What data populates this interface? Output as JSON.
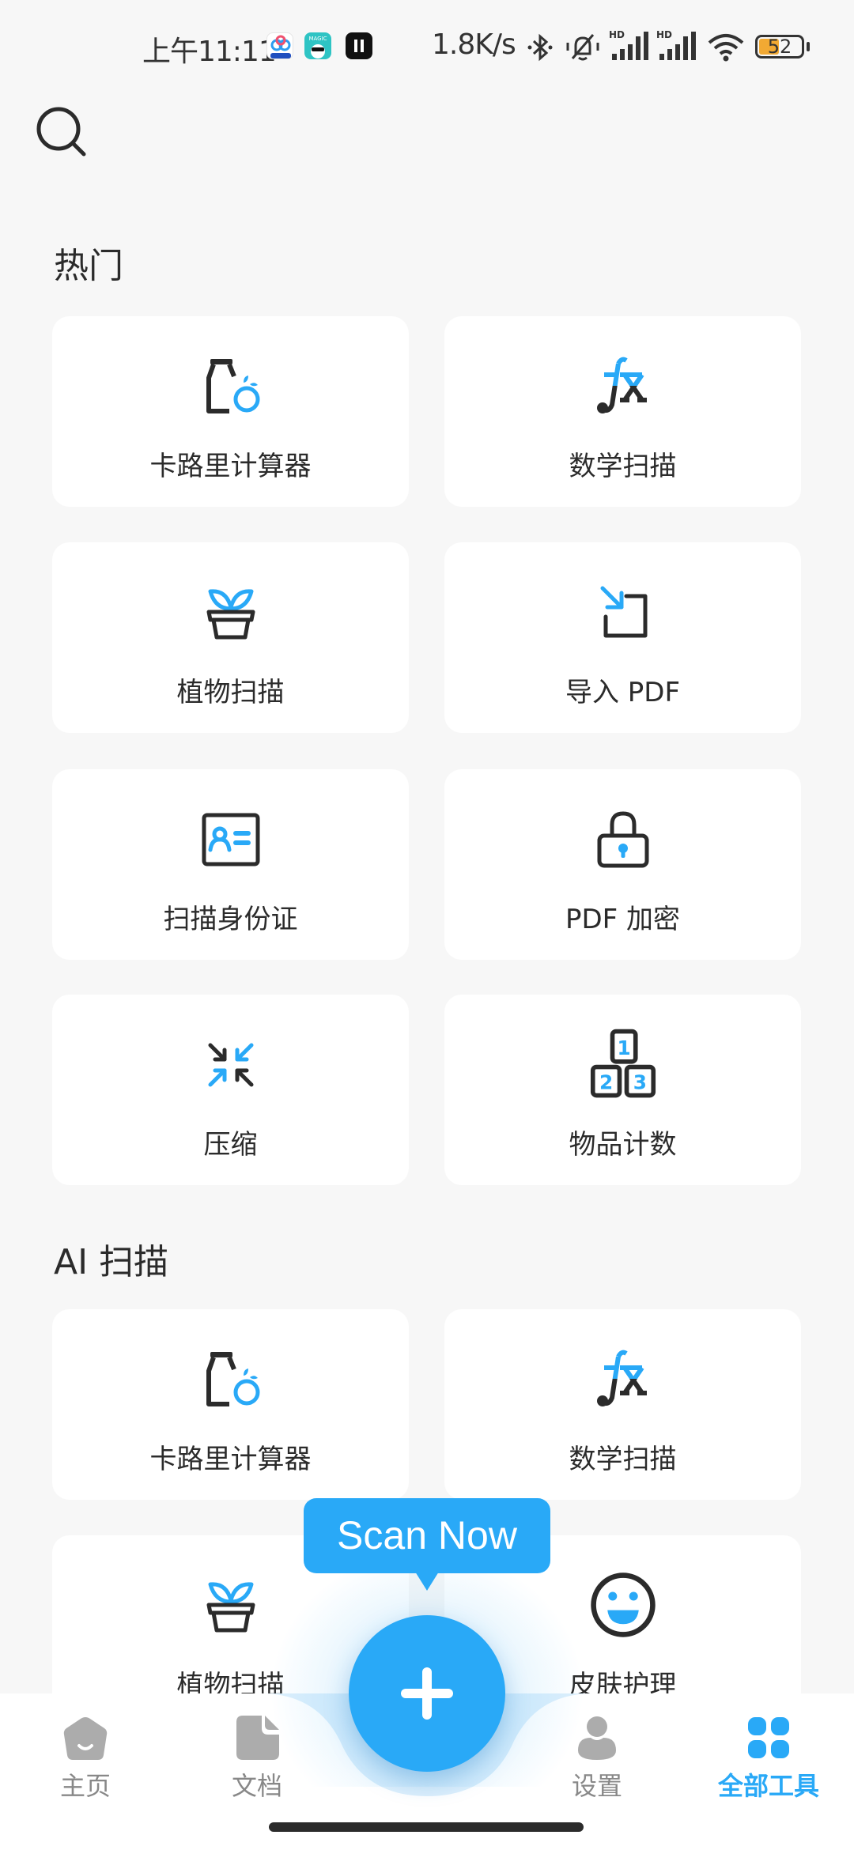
{
  "status_bar": {
    "time": "上午11:11",
    "network_speed": "1.8K/s",
    "battery_level": "52",
    "battery_percent": 52,
    "icons": [
      "baidu-netdisk-app-icon",
      "magic-app-icon",
      "pause-app-icon",
      "bluetooth-icon",
      "muted-bell-icon",
      "hd-signal-icon",
      "hd-signal-icon",
      "wifi-icon",
      "battery-icon"
    ]
  },
  "search": {
    "icon": "search-icon"
  },
  "sections": [
    {
      "title": "热门",
      "items": [
        {
          "label": "卡路里计算器",
          "icon": "calorie-bottle-icon"
        },
        {
          "label": "数学扫描",
          "icon": "fx-math-icon"
        },
        {
          "label": "植物扫描",
          "icon": "plant-pot-icon"
        },
        {
          "label": "导入 PDF",
          "icon": "import-arrow-icon"
        },
        {
          "label": "扫描身份证",
          "icon": "id-card-icon"
        },
        {
          "label": "PDF 加密",
          "icon": "lock-icon"
        },
        {
          "label": "压缩",
          "icon": "compress-arrows-icon"
        },
        {
          "label": "物品计数",
          "icon": "count-blocks-icon"
        }
      ]
    },
    {
      "title": "AI 扫描",
      "items": [
        {
          "label": "卡路里计算器",
          "icon": "calorie-bottle-icon"
        },
        {
          "label": "数学扫描",
          "icon": "fx-math-icon"
        },
        {
          "label": "植物扫描",
          "icon": "plant-pot-icon"
        },
        {
          "label": "皮肤护理",
          "icon": "smile-face-icon"
        }
      ]
    }
  ],
  "scan_tooltip": "Scan Now",
  "fab": {
    "icon": "plus-icon"
  },
  "nav": {
    "items": [
      {
        "label": "主页",
        "icon": "home-icon",
        "active": false
      },
      {
        "label": "文档",
        "icon": "document-icon",
        "active": false
      },
      {
        "label": "设置",
        "icon": "person-icon",
        "active": false
      },
      {
        "label": "全部工具",
        "icon": "grid-icon",
        "active": true
      }
    ]
  },
  "colors": {
    "accent": "#29A9F7",
    "icon_dark": "#2B2B2B",
    "background": "#F7F7F7",
    "card": "#FFFFFF",
    "nav_inactive": "#888888",
    "battery_fill": "#F2A933"
  }
}
